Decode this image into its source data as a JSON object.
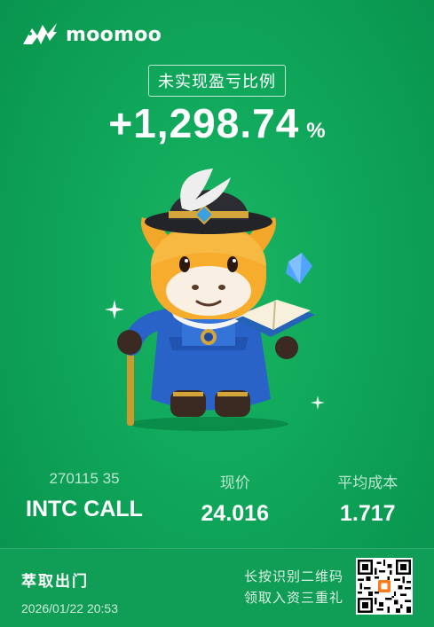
{
  "brand": {
    "name": "moomoo"
  },
  "headline": {
    "label": "未实现盈亏比例",
    "value": "+1,298.74",
    "unit": "%"
  },
  "stats": [
    {
      "label": "270115 35",
      "value": "INTC CALL"
    },
    {
      "label": "现价",
      "value": "24.016"
    },
    {
      "label": "平均成本",
      "value": "1.717"
    }
  ],
  "footer": {
    "slogan": "萃取出门",
    "timestamp": "2026/01/22 20:53",
    "qr_hint_line1": "长按识别二维码",
    "qr_hint_line2": "领取入资三重礼"
  },
  "colors": {
    "background": "#0fa65a",
    "accent": "#ffffff"
  }
}
